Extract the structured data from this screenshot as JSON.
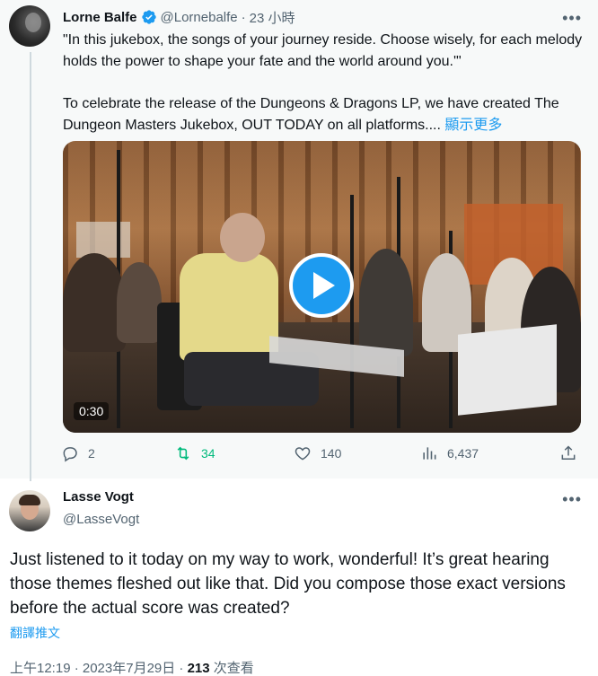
{
  "tweet": {
    "author_name": "Lorne Balfe",
    "handle": "@Lornebalfe",
    "separator": "·",
    "time": "23 小時",
    "text_quote": "\"In this jukebox, the songs of your journey reside. Choose wisely, for each melody holds the power to shape your fate and the world around you.'\"",
    "text_main": "To celebrate the release of the Dungeons & Dragons  LP, we have created The Dungeon Masters Jukebox, OUT TODAY on all platforms....",
    "show_more": "顯示更多",
    "video_duration": "0:30",
    "actions": {
      "replies": "2",
      "retweets": "34",
      "likes": "140",
      "views": "6,437"
    }
  },
  "reply": {
    "author_name": "Lasse Vogt",
    "handle": "@LasseVogt",
    "text": "Just listened to it today on my way to work, wonderful! It’s great hearing those themes fleshed out like that. Did you compose those exact versions before the actual score was created?",
    "translate_label": "翻譯推文",
    "timestamp": "上午12:19 · 2023年7月29日 · ",
    "view_count": "213",
    "view_suffix": " 次查看"
  },
  "icons": {
    "more": "more-icon",
    "verified": "verified-badge-icon",
    "reply": "reply-icon",
    "retweet": "retweet-icon",
    "like": "heart-icon",
    "views": "views-icon",
    "share": "share-icon",
    "play": "play-icon"
  },
  "colors": {
    "accent": "#1d9bf0",
    "retweet_active": "#00ba7c",
    "secondary_text": "#536471",
    "hover_bg": "#f7f9f9"
  }
}
